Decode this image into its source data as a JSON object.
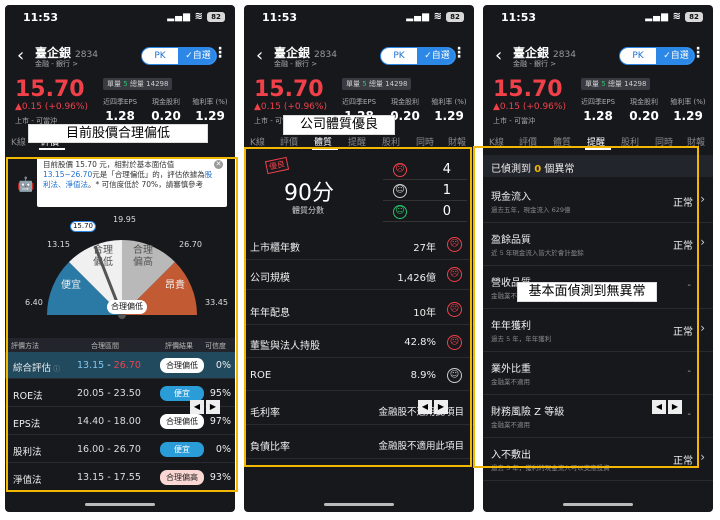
{
  "status": {
    "time": "11:53",
    "battery": "82"
  },
  "stock": {
    "name": "臺企銀",
    "code": "2834",
    "sector": "金融 - 銀行 >",
    "price": "15.70",
    "change": "▲0.15 (+0.96%)",
    "tradable": "上市 - 可當沖",
    "badge_prefix": "單量",
    "badge_num": "5",
    "badge_total": "總量 14298",
    "pk": "PK",
    "watch": "✓自選",
    "metrics": [
      {
        "label": "近四季EPS",
        "value": "1.28"
      },
      {
        "label": "現金股利",
        "value": "0.20"
      },
      {
        "label": "殖利率 (%)",
        "value": "1.29"
      }
    ]
  },
  "tabs": [
    "K線",
    "評價",
    "體質",
    "提醒",
    "股利",
    "同時",
    "財報"
  ],
  "captions": {
    "p1": "目前股價合理偏低",
    "p2": "公司體質優良",
    "p3": "基本面偵測到無異常"
  },
  "p1": {
    "bubble_pre": "目前股價 15.70 元，相對於基本面估值",
    "bubble_range": "13.15~26.70",
    "bubble_mid": "元是「合理偏低」的，評估依據為",
    "bubble_methods": "股利法、淨值法",
    "bubble_post": "。* 可信度低於 70%，請審慎參考",
    "gauge_ticks": {
      "t1": "6.40",
      "t2": "13.15",
      "t3": "19.95",
      "t4": "26.70",
      "t5": "33.45"
    },
    "current_marker": "15.70",
    "zones": {
      "z1": "便宜",
      "z2": "合理\n偏低",
      "z3": "合理\n偏高",
      "z4": "昂貴"
    },
    "needle_label": "合理偏低",
    "headers": [
      "評價方法",
      "合理區間",
      "評價結果",
      "可信度"
    ],
    "rows": [
      {
        "method": "綜合評估",
        "low": "13.15",
        "sep": " - ",
        "high": "26.70",
        "result": "合理偏低",
        "pct": "0%"
      },
      {
        "method": "ROE法",
        "range": "20.05 - 23.50",
        "result": "便宜",
        "pct": "95%"
      },
      {
        "method": "EPS法",
        "range": "14.40 - 18.00",
        "result": "合理偏低",
        "pct": "97%"
      },
      {
        "method": "股利法",
        "range": "16.00 - 26.70",
        "result": "便宜",
        "pct": "0%"
      },
      {
        "method": "淨值法",
        "range": "13.15 - 17.55",
        "result": "合理偏高",
        "pct": "93%"
      }
    ]
  },
  "p2": {
    "stamp": "優良",
    "score": "90分",
    "score_label": "體質分數",
    "counts": [
      {
        "face": "☹",
        "n": "4"
      },
      {
        "face": "☺",
        "n": "1"
      },
      {
        "face": "☺",
        "n": "0"
      }
    ],
    "rows": [
      {
        "k": "上市櫃年數",
        "v": "27年"
      },
      {
        "k": "公司規模",
        "v": "1,426億"
      },
      {
        "k": "年年配息",
        "v": "10年"
      },
      {
        "k": "董監與法人持股",
        "v": "42.8%"
      },
      {
        "k": "ROE",
        "v": "8.9%"
      },
      {
        "k": "毛利率",
        "v": "金融股不適用此項目"
      },
      {
        "k": "負債比率",
        "v": "金融股不適用此項目"
      }
    ]
  },
  "p3": {
    "abn_pre": "已偵測到 ",
    "abn_num": "0",
    "abn_post": " 個異常",
    "rows": [
      {
        "t": "現金流入",
        "s": "過去五年，現金流入 629億",
        "st": "正常"
      },
      {
        "t": "盈餘品質",
        "s": "近 5 年現金流入皆大於會計盈餘",
        "st": "正常"
      },
      {
        "t": "營收品質",
        "s": "金融業不適用",
        "st": "-"
      },
      {
        "t": "年年獲利",
        "s": "過去 5 年，年年獲利",
        "st": "正常"
      },
      {
        "t": "業外比重",
        "s": "金融業不適用",
        "st": "-"
      },
      {
        "t": "財務風險 Z 等級",
        "s": "金融業不適用",
        "st": "-"
      },
      {
        "t": "入不敷出",
        "s": "過去 5 年，獲利的現金流入可以支應投資",
        "st": "正常"
      }
    ]
  }
}
